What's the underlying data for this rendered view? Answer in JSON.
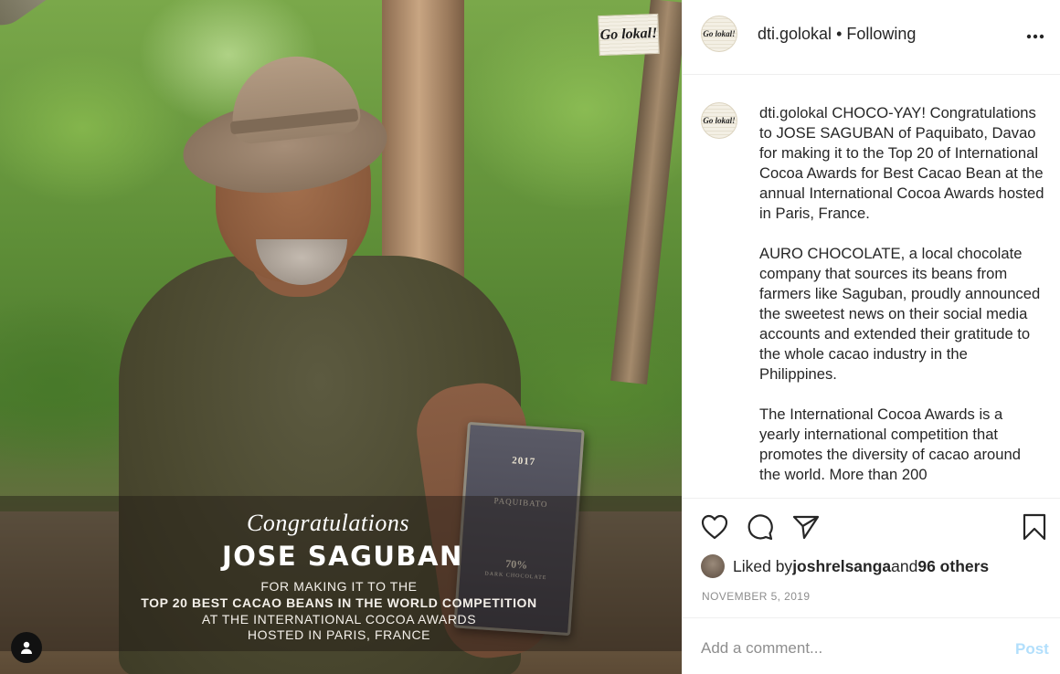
{
  "photo": {
    "logo_text": "Go lokal!",
    "overlay": {
      "congrats": "Congratulations",
      "name": "JOSE SAGUBAN",
      "line1": "FOR MAKING IT TO THE",
      "line2": "TOP 20 BEST CACAO BEANS IN THE WORLD COMPETITION",
      "line3": "AT THE INTERNATIONAL COCOA AWARDS",
      "line4": "HOSTED IN PARIS, FRANCE"
    },
    "product": {
      "year": "2017",
      "name": "PAQUIBATO",
      "percent": "70%",
      "kind": "DARK CHOCOLATE"
    }
  },
  "header": {
    "username": "dti.golokal",
    "separator": " • ",
    "follow_status": "Following"
  },
  "caption": {
    "username": "dti.golokal",
    "text": " CHOCO-YAY! Congratulations to JOSE SAGUBAN of Paquibato, Davao for making it to the Top 20 of International Cocoa Awards for Best Cacao Bean at the annual International Cocoa Awards hosted in Paris, France.\n\nAURO CHOCOLATE, a local chocolate company that sources its beans from farmers like Saguban, proudly announced the sweetest news on their social media accounts and extended their gratitude to the whole cacao industry in the Philippines.\n\nThe International Cocoa Awards is a yearly international competition that promotes the diversity of cacao around the world. More than 200"
  },
  "actions": {
    "icons": [
      "heart-icon",
      "comment-icon",
      "share-icon",
      "bookmark-icon"
    ]
  },
  "likes": {
    "prefix": "Liked by ",
    "first_user": "joshrelsanga",
    "middle": " and ",
    "others": "96 others"
  },
  "post_date": "NOVEMBER 5, 2019",
  "comment": {
    "placeholder": "Add a comment...",
    "post_label": "Post"
  },
  "colors": {
    "link_disabled": "#b2dffc",
    "muted": "#8e8e8e",
    "text": "#262626"
  }
}
